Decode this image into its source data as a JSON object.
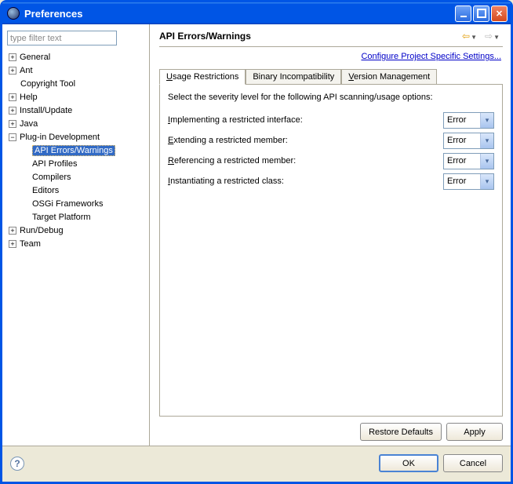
{
  "window": {
    "title": "Preferences"
  },
  "sidebar": {
    "filter_placeholder": "type filter text",
    "items": {
      "general": "General",
      "ant": "Ant",
      "copyright_tool": "Copyright Tool",
      "help": "Help",
      "install_update": "Install/Update",
      "java": "Java",
      "plugin_dev": "Plug-in Development",
      "api_errors_warnings": "API Errors/Warnings",
      "api_profiles": "API Profiles",
      "compilers": "Compilers",
      "editors": "Editors",
      "osgi_frameworks": "OSGi Frameworks",
      "target_platform": "Target Platform",
      "run_debug": "Run/Debug",
      "team": "Team"
    }
  },
  "main": {
    "title": "API Errors/Warnings",
    "project_settings_link": "Configure Project Specific Settings...",
    "tabs": {
      "usage": "sage Restrictions",
      "usage_m": "U",
      "binary": "Binary Incompatibility",
      "version": "ersion Management",
      "version_m": "V"
    },
    "intro": "Select the severity level for the following API scanning/usage options:",
    "options": {
      "impl": {
        "m": "I",
        "rest": "mplementing a restricted interface:",
        "value": "Error"
      },
      "ext": {
        "m": "E",
        "rest": "xtending a restricted member:",
        "value": "Error"
      },
      "ref": {
        "m": "R",
        "rest": "eferencing a restricted member:",
        "value": "Error"
      },
      "inst": {
        "m": "I",
        "rest": "nstantiating a restricted class:",
        "value": "Error"
      }
    },
    "buttons": {
      "restore": "Restore Defaults",
      "apply": "Apply",
      "ok": "OK",
      "cancel": "Cancel"
    }
  }
}
